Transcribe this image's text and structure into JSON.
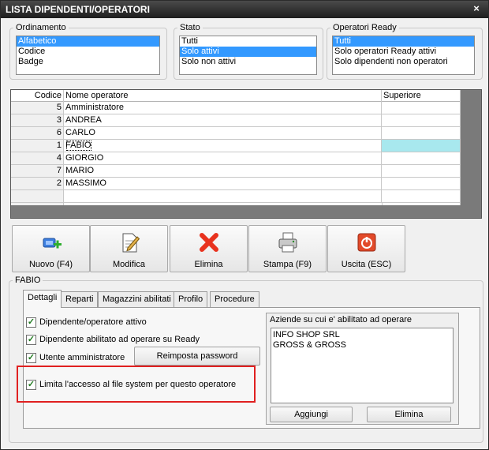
{
  "window": {
    "title": "LISTA DIPENDENTI/OPERATORI",
    "close_glyph": "×"
  },
  "filters": {
    "ordinamento": {
      "label": "Ordinamento",
      "options": [
        "Alfabetico",
        "Codice",
        "Badge"
      ],
      "selected": 0
    },
    "stato": {
      "label": "Stato",
      "options": [
        "Tutti",
        "Solo attivi",
        "Solo non attivi"
      ],
      "selected": 1
    },
    "operatori_ready": {
      "label": "Operatori Ready",
      "options": [
        "Tutti",
        "Solo operatori Ready attivi",
        "Solo dipendenti non operatori"
      ],
      "selected": 0
    }
  },
  "grid": {
    "columns": [
      "Codice",
      "Nome operatore",
      "Superiore"
    ],
    "rows": [
      {
        "code": "5",
        "name": "Amministratore",
        "superior": ""
      },
      {
        "code": "3",
        "name": "ANDREA",
        "superior": ""
      },
      {
        "code": "6",
        "name": "CARLO",
        "superior": ""
      },
      {
        "code": "1",
        "name": "FABIO",
        "superior": ""
      },
      {
        "code": "4",
        "name": "GIORGIO",
        "superior": ""
      },
      {
        "code": "7",
        "name": "MARIO",
        "superior": ""
      },
      {
        "code": "2",
        "name": "MASSIMO",
        "superior": ""
      }
    ],
    "selected_index": 3,
    "empty_rows": 1
  },
  "toolbar": {
    "new_label": "Nuovo (F4)",
    "edit_label": "Modifica",
    "delete_label": "Elimina",
    "print_label": "Stampa (F9)",
    "exit_label": "Uscita (ESC)"
  },
  "detail": {
    "group_label": "FABIO",
    "tabs": [
      "Dettagli",
      "Reparti",
      "Magazzini abilitati",
      "Profilo",
      "Procedure"
    ],
    "active_tab": 0,
    "checkboxes": {
      "active": {
        "label": "Dipendente/operatore attivo",
        "checked": true
      },
      "ready": {
        "label": "Dipendente abilitato ad operare su Ready",
        "checked": true
      },
      "admin": {
        "label": "Utente amministratore",
        "checked": true
      },
      "fs_limit": {
        "label": "Limita l'accesso al file system per questo operatore",
        "checked": true
      }
    },
    "reset_password_label": "Reimposta password",
    "companies": {
      "label": "Aziende su cui e' abilitato ad operare",
      "items": [
        "INFO SHOP SRL",
        "GROSS & GROSS"
      ],
      "add_label": "Aggiungi",
      "delete_label": "Elimina"
    }
  },
  "colors": {
    "selection": "#3399ff",
    "row_highlight": "#a8e8ee",
    "highlight_box": "#e02020"
  }
}
